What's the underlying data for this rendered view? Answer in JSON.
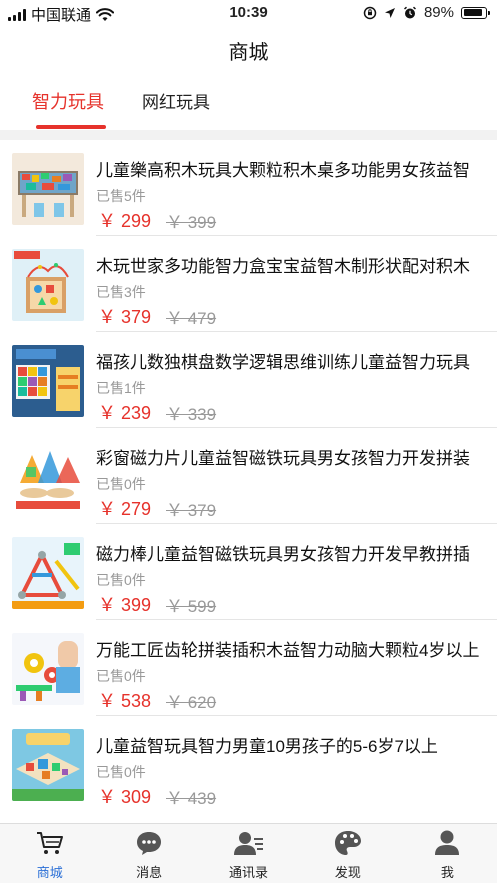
{
  "status_bar": {
    "carrier": "中国联通",
    "time": "10:39",
    "battery": "89%",
    "battery_level": 0.89
  },
  "nav": {
    "title": "商城"
  },
  "tabs": [
    {
      "label": "智力玩具",
      "active": true
    },
    {
      "label": "网红玩具",
      "active": false
    }
  ],
  "colors": {
    "accent": "#e6322b",
    "tab_active": "#2a6fd6",
    "muted": "#999999"
  },
  "products": [
    {
      "title": "儿童樂高积木玩具大颗粒积木桌多功能男女孩益智",
      "sold": "已售5件",
      "price": "￥ 299",
      "orig": "￥ 399"
    },
    {
      "title": "木玩世家多功能智力盒宝宝益智木制形状配对积木",
      "sold": "已售3件",
      "price": "￥ 379",
      "orig": "￥ 479"
    },
    {
      "title": "福孩儿数独棋盘数学逻辑思维训练儿童益智力玩具",
      "sold": "已售1件",
      "price": "￥ 239",
      "orig": "￥ 339"
    },
    {
      "title": "彩窗磁力片儿童益智磁铁玩具男女孩智力开发拼装",
      "sold": "已售0件",
      "price": "￥ 279",
      "orig": "￥ 379"
    },
    {
      "title": "磁力棒儿童益智磁铁玩具男女孩智力开发早教拼插",
      "sold": "已售0件",
      "price": "￥ 399",
      "orig": "￥ 599"
    },
    {
      "title": "万能工匠齿轮拼装插积木益智力动脑大颗粒4岁以上",
      "sold": "已售0件",
      "price": "￥ 538",
      "orig": "￥ 620"
    },
    {
      "title": "儿童益智玩具智力男童10男孩子的5-6岁7以上",
      "sold": "已售0件",
      "price": "￥ 309",
      "orig": "￥ 439"
    }
  ],
  "tabbar": [
    {
      "label": "商城",
      "icon": "cart-icon",
      "active": true
    },
    {
      "label": "消息",
      "icon": "chat-icon",
      "active": false
    },
    {
      "label": "通讯录",
      "icon": "contacts-icon",
      "active": false
    },
    {
      "label": "发现",
      "icon": "discover-icon",
      "active": false
    },
    {
      "label": "我",
      "icon": "profile-icon",
      "active": false
    }
  ]
}
